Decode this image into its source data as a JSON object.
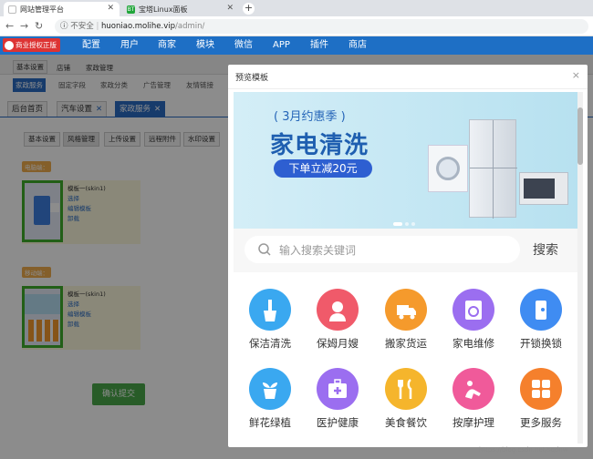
{
  "browser": {
    "tabs": [
      {
        "title": "网站管理平台",
        "active": true
      },
      {
        "title": "宝塔Linux面板",
        "active": false
      }
    ],
    "address": {
      "security": "不安全",
      "host": "huoniao.molihe.vip",
      "path": "/admin/"
    }
  },
  "header": {
    "brand": "商业授权正版",
    "nav": [
      "配置",
      "用户",
      "商家",
      "模块",
      "微信",
      "APP",
      "插件",
      "商店"
    ]
  },
  "subnav1": [
    "基本设置",
    "店铺",
    "家政管理"
  ],
  "subnav2": [
    "家政服务",
    "固定字段",
    "家政分类",
    "广告管理",
    "友情链接"
  ],
  "pagetabs": [
    {
      "label": "后台首页",
      "closable": false
    },
    {
      "label": "汽车设置",
      "closable": true
    },
    {
      "label": "家政服务",
      "closable": true,
      "active": true
    }
  ],
  "settingtabs": [
    "基本设置",
    "风格管理",
    "上传设置",
    "远程附件",
    "水印设置"
  ],
  "templates": [
    {
      "category": "电脑端：",
      "name": "模板一(skin1)",
      "actions": [
        "选择",
        "编辑模板",
        "卸载"
      ]
    },
    {
      "category": "移动端：",
      "name": "模板一(skin1)",
      "actions": [
        "选择",
        "编辑模板",
        "卸载"
      ]
    }
  ],
  "confirm_label": "确认提交",
  "modal": {
    "title": "预览模板",
    "close": "×",
    "banner": {
      "line1": "3月约惠季",
      "line2": "家电清洗",
      "line3": "下单立减20元"
    },
    "search": {
      "placeholder": "输入搜索关键词",
      "button": "搜索"
    },
    "services": [
      {
        "label": "保洁清洗",
        "icon": "broom-icon",
        "color": "#3aa8f0"
      },
      {
        "label": "保姆月嫂",
        "icon": "nanny-icon",
        "color": "#f05a6a"
      },
      {
        "label": "搬家货运",
        "icon": "truck-icon",
        "color": "#f59a2c"
      },
      {
        "label": "家电维修",
        "icon": "washer-icon",
        "color": "#9b6ef0"
      },
      {
        "label": "开锁换锁",
        "icon": "lock-icon",
        "color": "#3f8cf2"
      },
      {
        "label": "鲜花绿植",
        "icon": "plant-icon",
        "color": "#3aa8f0"
      },
      {
        "label": "医护健康",
        "icon": "medkit-icon",
        "color": "#9b6ef0"
      },
      {
        "label": "美食餐饮",
        "icon": "cutlery-icon",
        "color": "#f5b52c"
      },
      {
        "label": "按摩护理",
        "icon": "massage-icon",
        "color": "#f05a9a"
      },
      {
        "label": "更多服务",
        "icon": "grid-icon",
        "color": "#f5802c"
      }
    ]
  },
  "watermark": "https://blog.csdn.net/sqdnw"
}
